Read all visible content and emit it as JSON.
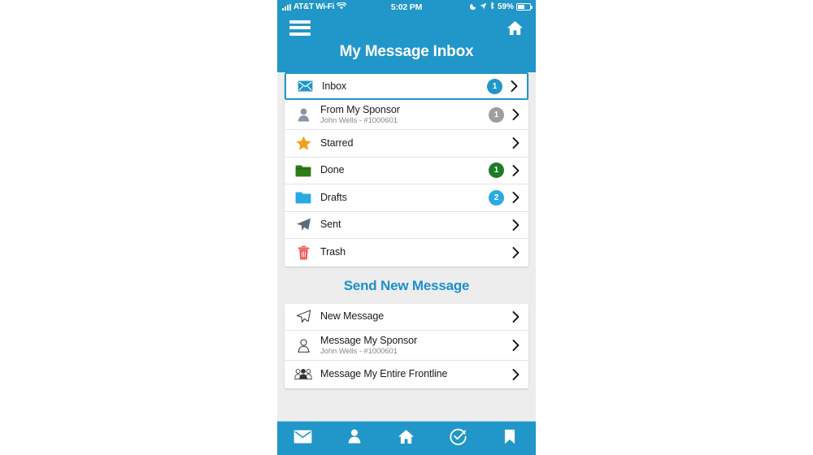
{
  "status_bar": {
    "carrier": "AT&T Wi-Fi",
    "time": "5:02 PM",
    "battery_percent": "59%",
    "icons": {
      "signal": "signal-bars-icon",
      "wifi": "wifi-icon",
      "dnd": "moon-icon",
      "location": "location-arrow-icon",
      "bluetooth": "bluetooth-icon",
      "battery": "battery-icon"
    }
  },
  "header": {
    "menu_icon": "hamburger-menu-icon",
    "home_icon": "home-icon",
    "title": "My Message Inbox"
  },
  "colors": {
    "brand_blue": "#2196c8",
    "section_blue": "#1c8fd0",
    "badge_blue": "#29abe2",
    "badge_gray": "#9e9e9e",
    "badge_green": "#1f7a28",
    "star_orange": "#f0a01e",
    "folder_green": "#2e7d17",
    "folder_blue": "#29abe2",
    "trash_red": "#f05a5a",
    "sent_slate": "#5c6b7a",
    "page_background": "#ededed"
  },
  "inbox_list": [
    {
      "id": "inbox",
      "label": "Inbox",
      "subtitle": "",
      "icon": "envelope-filled-icon",
      "badge": "1",
      "badge_color": "#2196c8",
      "selected": true
    },
    {
      "id": "from-my-sponsor",
      "label": "From My Sponsor",
      "subtitle": "John Wells - #1000601",
      "icon": "person-filled-icon",
      "badge": "1",
      "badge_color": "#9e9e9e",
      "selected": false
    },
    {
      "id": "starred",
      "label": "Starred",
      "subtitle": "",
      "icon": "star-icon",
      "badge": "",
      "badge_color": "",
      "selected": false
    },
    {
      "id": "done",
      "label": "Done",
      "subtitle": "",
      "icon": "folder-green-icon",
      "badge": "1",
      "badge_color": "#1f7a28",
      "selected": false
    },
    {
      "id": "drafts",
      "label": "Drafts",
      "subtitle": "",
      "icon": "folder-blue-icon",
      "badge": "2",
      "badge_color": "#29abe2",
      "selected": false
    },
    {
      "id": "sent",
      "label": "Sent",
      "subtitle": "",
      "icon": "paper-plane-icon",
      "badge": "",
      "badge_color": "",
      "selected": false
    },
    {
      "id": "trash",
      "label": "Trash",
      "subtitle": "",
      "icon": "trash-icon",
      "badge": "",
      "badge_color": "",
      "selected": false
    }
  ],
  "compose_section": {
    "title": "Send New Message",
    "items": [
      {
        "id": "new-message",
        "label": "New Message",
        "subtitle": "",
        "icon": "paper-plane-outline-icon"
      },
      {
        "id": "message-my-sponsor",
        "label": "Message My Sponsor",
        "subtitle": "John Wells - #1000601",
        "icon": "person-outline-icon"
      },
      {
        "id": "message-my-entire-frontline",
        "label": "Message My Entire Frontline",
        "subtitle": "",
        "icon": "group-people-icon"
      }
    ]
  },
  "tab_bar": {
    "items": [
      {
        "id": "messages",
        "icon": "envelope-icon"
      },
      {
        "id": "profile",
        "icon": "person-icon"
      },
      {
        "id": "home",
        "icon": "home-icon"
      },
      {
        "id": "tasks",
        "icon": "check-circle-icon"
      },
      {
        "id": "bookmarks",
        "icon": "bookmark-icon"
      }
    ]
  }
}
